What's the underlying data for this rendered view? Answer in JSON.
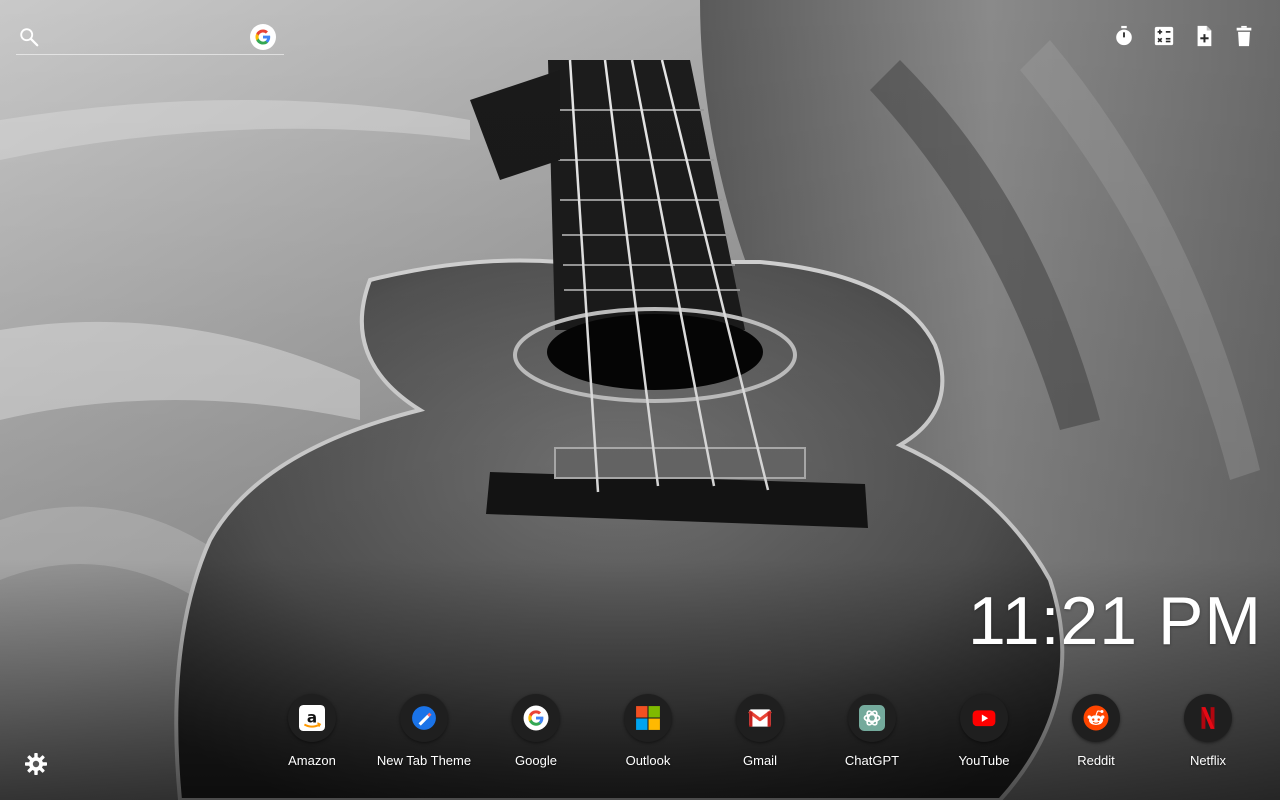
{
  "search": {
    "value": "",
    "placeholder": "",
    "engine_icon": "google-g-icon"
  },
  "toolbar": {
    "icons": [
      "timer-icon",
      "calculator-icon",
      "new-note-icon",
      "trash-icon"
    ]
  },
  "clock": {
    "time": "11:21 PM"
  },
  "shortcuts": [
    {
      "label": "Amazon",
      "icon": "amazon-icon"
    },
    {
      "label": "New Tab Theme",
      "icon": "new-tab-theme-icon"
    },
    {
      "label": "Google",
      "icon": "google-icon"
    },
    {
      "label": "Outlook",
      "icon": "outlook-icon"
    },
    {
      "label": "Gmail",
      "icon": "gmail-icon"
    },
    {
      "label": "ChatGPT",
      "icon": "chatgpt-icon"
    },
    {
      "label": "YouTube",
      "icon": "youtube-icon"
    },
    {
      "label": "Reddit",
      "icon": "reddit-icon"
    },
    {
      "label": "Netflix",
      "icon": "netflix-icon"
    }
  ],
  "settings": {
    "icon": "gear-icon"
  },
  "colors": {
    "google_blue": "#4285F4",
    "google_red": "#EA4335",
    "google_yellow": "#FBBC05",
    "google_green": "#34A853",
    "youtube_red": "#FF0000",
    "reddit_orange": "#FF4500",
    "netflix_red": "#E50914",
    "chatgpt_green": "#74AA9C",
    "dock_circle": "#1F1F1F"
  }
}
